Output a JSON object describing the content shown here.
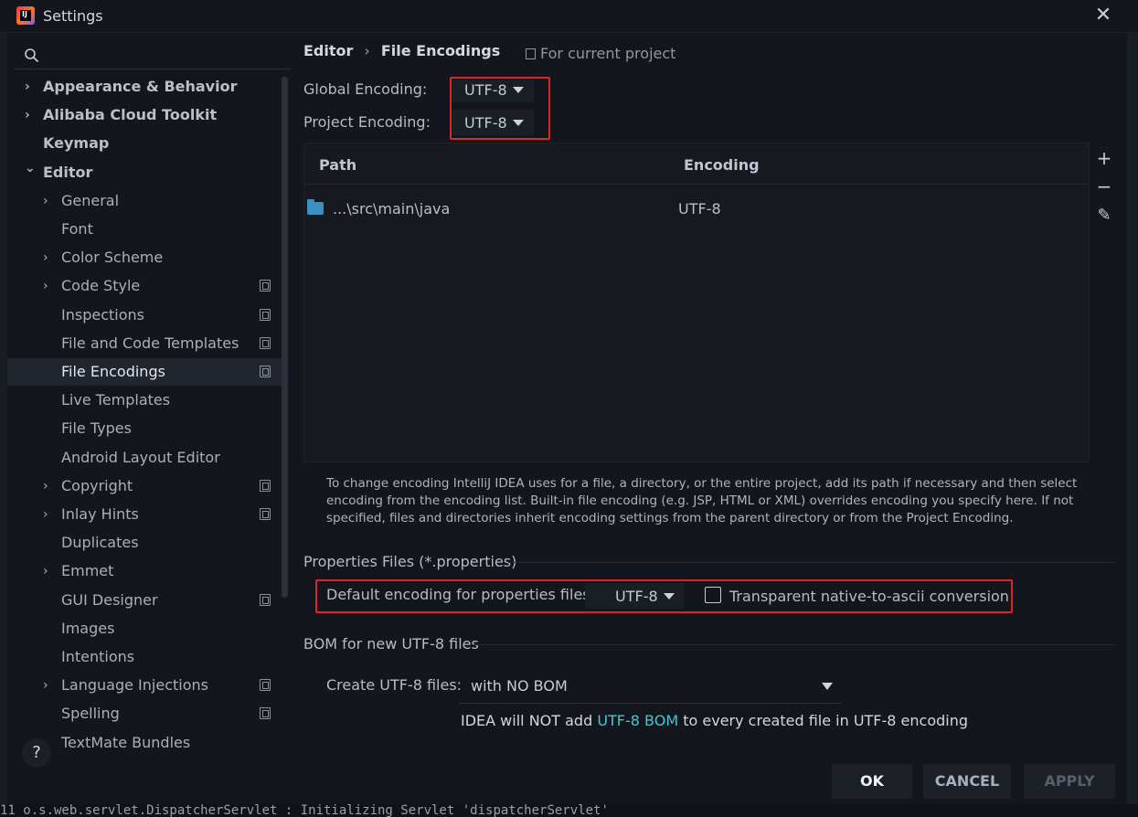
{
  "window": {
    "title": "Settings",
    "close_glyph": "✕",
    "app_icon": "intellij-idea-logo",
    "logo_text": "IJ"
  },
  "sidebar": {
    "search_icon": "magnifier-icon",
    "items": [
      {
        "label": "Appearance & Behavior",
        "bold": true,
        "chevron": "›",
        "indent": 0,
        "has_project_icon": false
      },
      {
        "label": "Alibaba Cloud Toolkit",
        "bold": true,
        "chevron": "›",
        "indent": 0,
        "has_project_icon": false
      },
      {
        "label": "Keymap",
        "bold": true,
        "chevron": "",
        "indent": 0,
        "has_project_icon": false
      },
      {
        "label": "Editor",
        "bold": true,
        "chevron": "⌄",
        "indent": 0,
        "has_project_icon": false
      },
      {
        "label": "General",
        "bold": false,
        "chevron": "›",
        "indent": 1,
        "has_project_icon": false
      },
      {
        "label": "Font",
        "bold": false,
        "chevron": "",
        "indent": 1,
        "has_project_icon": false
      },
      {
        "label": "Color Scheme",
        "bold": false,
        "chevron": "›",
        "indent": 1,
        "has_project_icon": false
      },
      {
        "label": "Code Style",
        "bold": false,
        "chevron": "›",
        "indent": 1,
        "has_project_icon": true
      },
      {
        "label": "Inspections",
        "bold": false,
        "chevron": "",
        "indent": 1,
        "has_project_icon": true
      },
      {
        "label": "File and Code Templates",
        "bold": false,
        "chevron": "",
        "indent": 1,
        "has_project_icon": true
      },
      {
        "label": "File Encodings",
        "bold": false,
        "chevron": "",
        "indent": 1,
        "has_project_icon": true,
        "selected": true
      },
      {
        "label": "Live Templates",
        "bold": false,
        "chevron": "",
        "indent": 1,
        "has_project_icon": false
      },
      {
        "label": "File Types",
        "bold": false,
        "chevron": "",
        "indent": 1,
        "has_project_icon": false
      },
      {
        "label": "Android Layout Editor",
        "bold": false,
        "chevron": "",
        "indent": 1,
        "has_project_icon": false
      },
      {
        "label": "Copyright",
        "bold": false,
        "chevron": "›",
        "indent": 1,
        "has_project_icon": true
      },
      {
        "label": "Inlay Hints",
        "bold": false,
        "chevron": "›",
        "indent": 1,
        "has_project_icon": true
      },
      {
        "label": "Duplicates",
        "bold": false,
        "chevron": "",
        "indent": 1,
        "has_project_icon": false
      },
      {
        "label": "Emmet",
        "bold": false,
        "chevron": "›",
        "indent": 1,
        "has_project_icon": false
      },
      {
        "label": "GUI Designer",
        "bold": false,
        "chevron": "",
        "indent": 1,
        "has_project_icon": true
      },
      {
        "label": "Images",
        "bold": false,
        "chevron": "",
        "indent": 1,
        "has_project_icon": false
      },
      {
        "label": "Intentions",
        "bold": false,
        "chevron": "",
        "indent": 1,
        "has_project_icon": false
      },
      {
        "label": "Language Injections",
        "bold": false,
        "chevron": "›",
        "indent": 1,
        "has_project_icon": true
      },
      {
        "label": "Spelling",
        "bold": false,
        "chevron": "",
        "indent": 1,
        "has_project_icon": true
      },
      {
        "label": "TextMate Bundles",
        "bold": false,
        "chevron": "",
        "indent": 1,
        "has_project_icon": false
      }
    ],
    "help_label": "?"
  },
  "breadcrumb": {
    "parent": "Editor",
    "separator": "›",
    "current": "File Encodings",
    "scope_label": "For current project"
  },
  "encodings": {
    "global_label": "Global Encoding:",
    "global_value": "UTF-8",
    "project_label": "Project Encoding:",
    "project_value": "UTF-8"
  },
  "table": {
    "columns": [
      "Path",
      "Encoding"
    ],
    "rows": [
      {
        "path": "...\\src\\main\\java",
        "encoding": "UTF-8",
        "icon": "folder-icon"
      }
    ],
    "tools": {
      "add": "+",
      "remove": "−",
      "edit": "✎"
    }
  },
  "help_text": "To change encoding IntelliJ IDEA uses for a file, a directory, or the entire project, add its path if necessary and then select encoding from the encoding list. Built-in file encoding (e.g. JSP, HTML or XML) overrides encoding you specify here. If not specified, files and directories inherit encoding settings from the parent directory or from the Project Encoding.",
  "properties": {
    "section_title": "Properties Files (*.properties)",
    "default_label": "Default encoding for properties files:",
    "default_value": "UTF-8",
    "transparent_label": "Transparent native-to-ascii conversion",
    "transparent_checked": false
  },
  "bom": {
    "section_title": "BOM for new UTF-8 files",
    "create_label": "Create UTF-8 files:",
    "create_value": "with NO BOM",
    "note_prefix": "IDEA will NOT add ",
    "note_link": "UTF-8 BOM",
    "note_suffix": " to every created file in UTF-8 encoding"
  },
  "buttons": {
    "ok": "OK",
    "cancel": "CANCEL",
    "apply": "APPLY"
  },
  "background": {
    "log_line": "11 o.s.web.servlet.DispatcherServlet        : Initializing Servlet 'dispatcherServlet'"
  },
  "colors": {
    "highlight": "#e02424",
    "link": "#41c7d6",
    "selection": "#20252e",
    "folder": "#3d8fc2"
  }
}
